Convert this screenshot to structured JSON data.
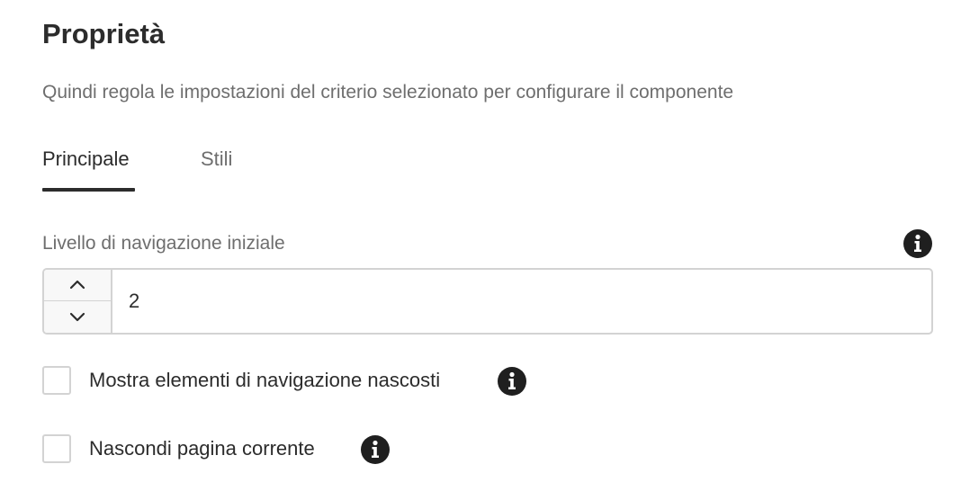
{
  "panel": {
    "title": "Proprietà",
    "subtitle": "Quindi regola le impostazioni del criterio selezionato per configurare il componente"
  },
  "tabs": [
    {
      "label": "Principale",
      "selected": true
    },
    {
      "label": "Stili",
      "selected": false
    }
  ],
  "fields": {
    "start_level": {
      "label": "Livello di navigazione iniziale",
      "value": "2",
      "info_icon": "info-icon",
      "increment_icon": "chevron-up-icon",
      "decrement_icon": "chevron-down-icon"
    },
    "show_hidden": {
      "label": "Mostra elementi di navigazione nascosti",
      "checked": false,
      "info_icon": "info-icon"
    },
    "hide_current": {
      "label": "Nascondi pagina corrente",
      "checked": false,
      "info_icon": "info-icon"
    }
  },
  "colors": {
    "text": "#2c2c2c",
    "muted_text": "#6e6e6e",
    "border": "#d3d3d3",
    "icon": "#1f1f1f"
  }
}
